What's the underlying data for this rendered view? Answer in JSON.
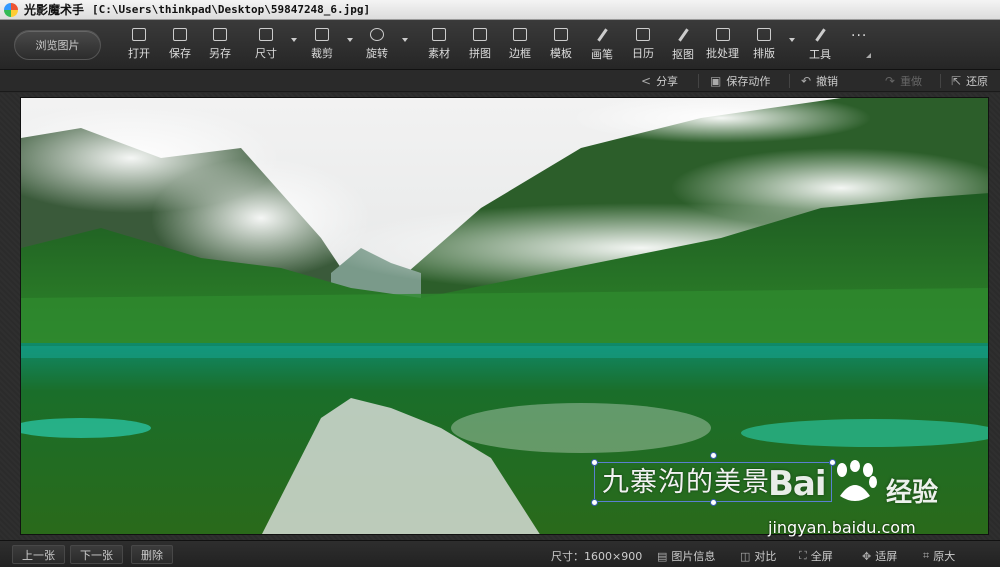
{
  "titlebar": {
    "app_name": "光影魔术手",
    "file_path": "[C:\\Users\\thinkpad\\Desktop\\59847248_6.jpg]"
  },
  "toolbar": {
    "browse_label": "浏览图片",
    "buttons": [
      {
        "label": "打开",
        "icon": "open-icon"
      },
      {
        "label": "保存",
        "icon": "save-icon"
      },
      {
        "label": "另存",
        "icon": "save-as-icon"
      },
      {
        "label": "尺寸",
        "icon": "resize-icon"
      },
      {
        "label": "裁剪",
        "icon": "crop-icon"
      },
      {
        "label": "旋转",
        "icon": "rotate-icon"
      },
      {
        "label": "素材",
        "icon": "material-icon"
      },
      {
        "label": "拼图",
        "icon": "collage-icon"
      },
      {
        "label": "边框",
        "icon": "border-icon"
      },
      {
        "label": "模板",
        "icon": "template-icon"
      },
      {
        "label": "画笔",
        "icon": "brush-icon"
      },
      {
        "label": "日历",
        "icon": "calendar-icon"
      },
      {
        "label": "抠图",
        "icon": "cutout-icon"
      },
      {
        "label": "批处理",
        "icon": "batch-icon"
      },
      {
        "label": "排版",
        "icon": "layout-icon"
      },
      {
        "label": "工具",
        "icon": "tools-icon"
      }
    ],
    "more_label": "···"
  },
  "subbar": {
    "share": "分享",
    "save_action": "保存动作",
    "undo": "撤销",
    "redo": "重做",
    "restore": "还原"
  },
  "canvas": {
    "text_overlay": "九寨沟的美景",
    "watermark_logo": "Bai",
    "watermark_cn": "经验",
    "watermark_url": "jingyan.baidu.com"
  },
  "statusbar": {
    "prev": "上一张",
    "next": "下一张",
    "delete": "删除",
    "size": "尺寸：1600×900",
    "image_info": "图片信息",
    "compare": "对比",
    "fullscreen": "全屏",
    "fit": "适屏",
    "actual_size": "原大"
  }
}
